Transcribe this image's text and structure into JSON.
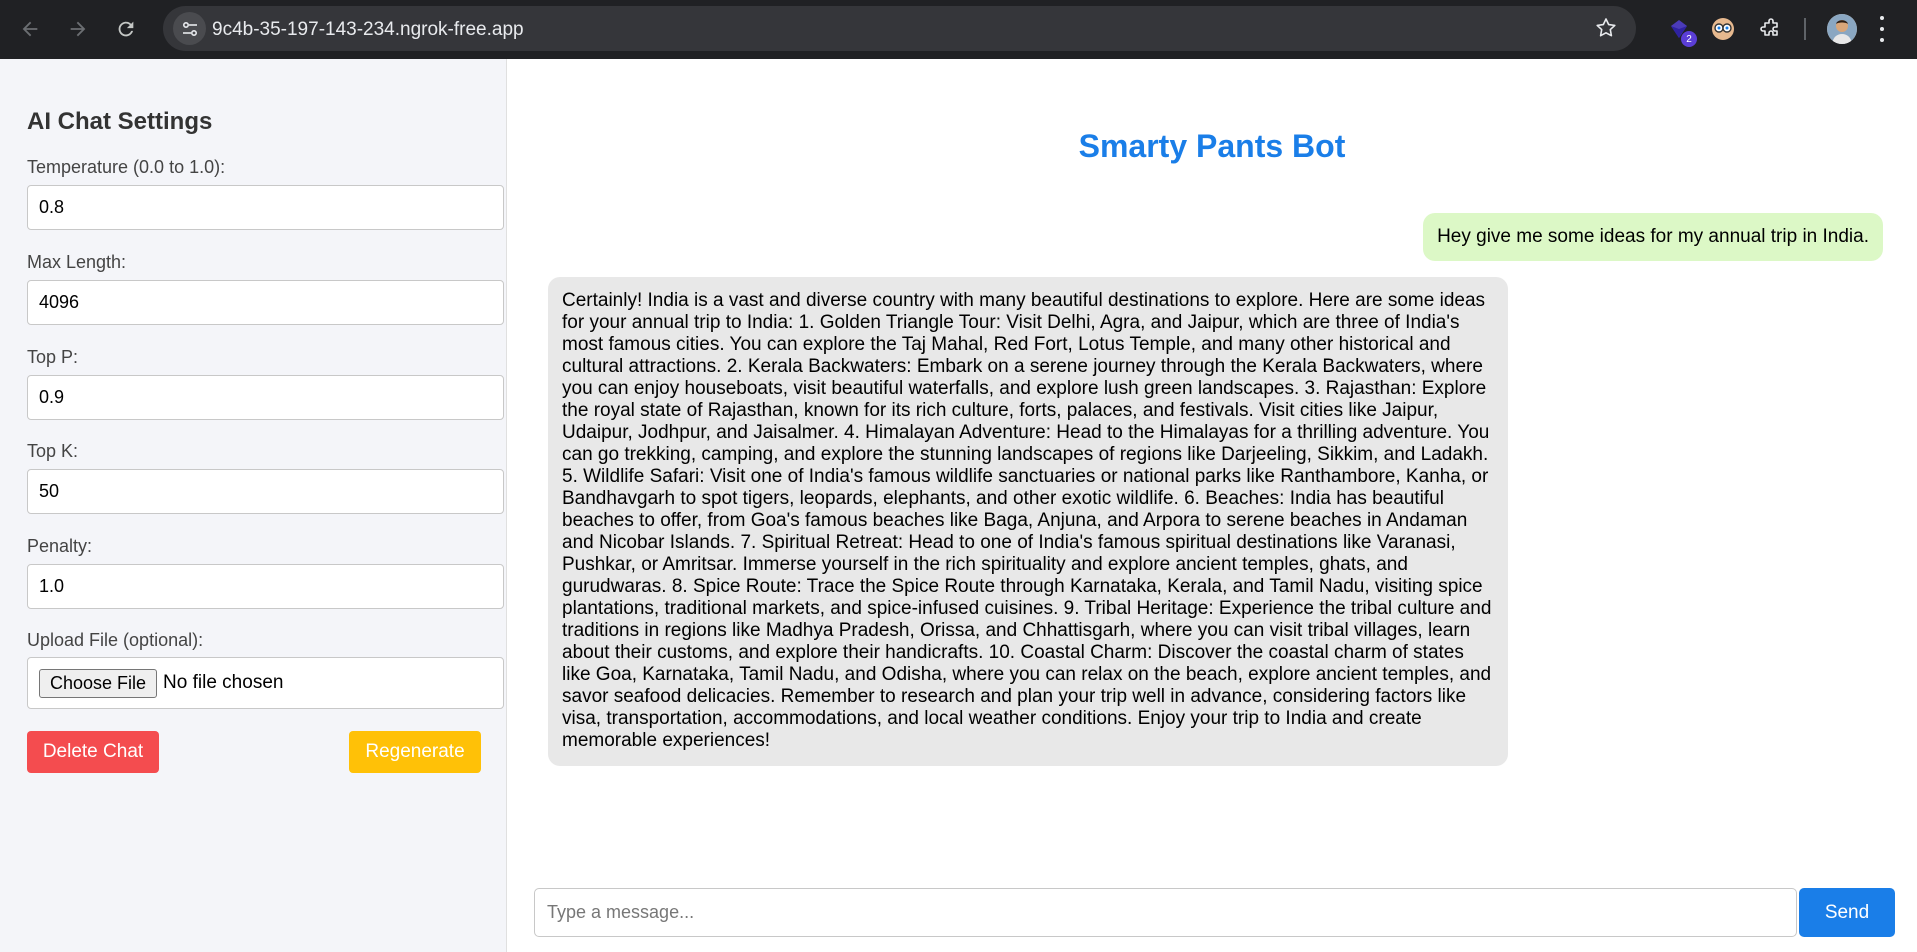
{
  "browser": {
    "url": "9c4b-35-197-143-234.ngrok-free.app",
    "extension_badge": "2"
  },
  "sidebar": {
    "title": "AI Chat Settings",
    "temperature": {
      "label": "Temperature (0.0 to 1.0):",
      "value": "0.8"
    },
    "max_length": {
      "label": "Max Length:",
      "value": "4096"
    },
    "top_p": {
      "label": "Top P:",
      "value": "0.9"
    },
    "top_k": {
      "label": "Top K:",
      "value": "50"
    },
    "penalty": {
      "label": "Penalty:",
      "value": "1.0"
    },
    "upload": {
      "label": "Upload File (optional):",
      "button": "Choose File",
      "status": "No file chosen"
    },
    "delete_label": "Delete Chat",
    "regenerate_label": "Regenerate"
  },
  "chat": {
    "title": "Smarty Pants Bot",
    "user_message": "Hey give me some ideas for my annual trip in India.",
    "bot_message": "Certainly! India is a vast and diverse country with many beautiful destinations to explore. Here are some ideas for your annual trip to India: 1. Golden Triangle Tour: Visit Delhi, Agra, and Jaipur, which are three of India's most famous cities. You can explore the Taj Mahal, Red Fort, Lotus Temple, and many other historical and cultural attractions. 2. Kerala Backwaters: Embark on a serene journey through the Kerala Backwaters, where you can enjoy houseboats, visit beautiful waterfalls, and explore lush green landscapes. 3. Rajasthan: Explore the royal state of Rajasthan, known for its rich culture, forts, palaces, and festivals. Visit cities like Jaipur, Udaipur, Jodhpur, and Jaisalmer. 4. Himalayan Adventure: Head to the Himalayas for a thrilling adventure. You can go trekking, camping, and explore the stunning landscapes of regions like Darjeeling, Sikkim, and Ladakh. 5. Wildlife Safari: Visit one of India's famous wildlife sanctuaries or national parks like Ranthambore, Kanha, or Bandhavgarh to spot tigers, leopards, elephants, and other exotic wildlife. 6. Beaches: India has beautiful beaches to offer, from Goa's famous beaches like Baga, Anjuna, and Arpora to serene beaches in Andaman and Nicobar Islands. 7. Spiritual Retreat: Head to one of India's famous spiritual destinations like Varanasi, Pushkar, or Amritsar. Immerse yourself in the rich spirituality and explore ancient temples, ghats, and gurudwaras. 8. Spice Route: Trace the Spice Route through Karnataka, Kerala, and Tamil Nadu, visiting spice plantations, traditional markets, and spice-infused cuisines. 9. Tribal Heritage: Experience the tribal culture and traditions in regions like Madhya Pradesh, Orissa, and Chhattisgarh, where you can visit tribal villages, learn about their customs, and explore their handicrafts. 10. Coastal Charm: Discover the coastal charm of states like Goa, Karnataka, Tamil Nadu, and Odisha, where you can relax on the beach, explore ancient temples, and savor seafood delicacies. Remember to research and plan your trip well in advance, considering factors like visa, transportation, accommodations, and local weather conditions. Enjoy your trip to India and create memorable experiences!",
    "input_placeholder": "Type a message...",
    "send_label": "Send"
  },
  "colors": {
    "accent": "#1a7ee8",
    "delete": "#f44c4f",
    "regenerate": "#ffc107",
    "user_bubble": "#dcf8c6",
    "bot_bubble": "#e8e8e8"
  },
  "icons": [
    "back-arrow-icon",
    "forward-arrow-icon",
    "reload-icon",
    "site-info-icon",
    "star-icon",
    "extension-puzzle-icon",
    "profile-avatar",
    "more-menu-icon"
  ]
}
